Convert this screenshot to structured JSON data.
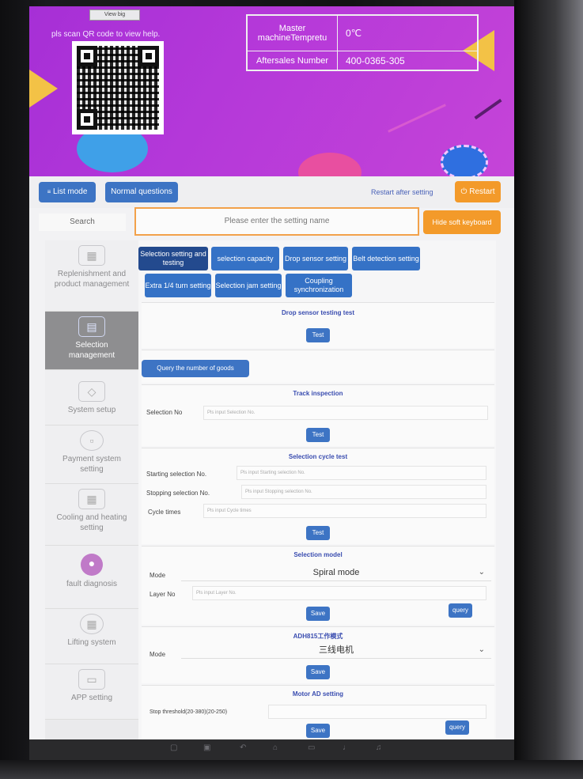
{
  "header": {
    "view_big": "View big",
    "scan_help": "pls scan QR code to view help.",
    "master_temp_label": "Master machineTempretu",
    "master_temp_value": "0℃",
    "aftersales_label": "Aftersales Number",
    "aftersales_value": "400-0365-305"
  },
  "toolbar": {
    "list_mode": "List mode",
    "normal_questions": "Normal questions",
    "restart_hint": "Restart after setting",
    "restart_button": "Restart",
    "search_label": "Search",
    "search_placeholder": "Please enter the setting name",
    "hide_keyboard": "Hide soft keyboard"
  },
  "sidebar": {
    "items": [
      {
        "label": "Replenishment and product management",
        "icon": "replenishment-icon"
      },
      {
        "label": "Selection management",
        "icon": "selection-icon"
      },
      {
        "label": "System setup",
        "icon": "layers-icon"
      },
      {
        "label": "Payment system setting",
        "icon": "payment-icon"
      },
      {
        "label": "Cooling and heating setting",
        "icon": "cooling-icon"
      },
      {
        "label": "fault diagnosis",
        "icon": "user-icon"
      },
      {
        "label": "Lifting system",
        "icon": "lifting-icon"
      },
      {
        "label": "APP setting",
        "icon": "app-icon"
      }
    ]
  },
  "tabs": [
    "Selection setting and testing",
    "selection capacity",
    "Drop sensor setting",
    "Belt detection setting",
    "Extra 1/4 turn setting",
    "Selection jam setting",
    "Coupling synchronization"
  ],
  "drop_sensor": {
    "title": "Drop sensor testing test",
    "test": "Test"
  },
  "query_goods": "Query the number of goods",
  "track": {
    "title": "Track inspection",
    "selection_label": "Selection No",
    "selection_placeholder": "Pls input Selection No.",
    "test": "Test"
  },
  "cycle": {
    "title": "Selection cycle test",
    "start_label": "Starting selection No.",
    "start_placeholder": "Pls input Starting selection No.",
    "stop_label": "Stopping selection No.",
    "stop_placeholder": "Pls input Stopping selection No.",
    "times_label": "Cycle times",
    "times_placeholder": "Pls input Cycle times",
    "test": "Test"
  },
  "model": {
    "title": "Selection model",
    "mode_label": "Mode",
    "mode_value": "Spiral mode",
    "layer_label": "Layer No",
    "layer_placeholder": "Pls input Layer No.",
    "save": "Save",
    "query": "query"
  },
  "adh": {
    "title": "ADH815工作模式",
    "mode_label": "Mode",
    "mode_value": "三线电机",
    "save": "Save"
  },
  "motor": {
    "title": "Motor AD setting",
    "stop_label": "Stop threshold(20-380)(20-250)",
    "save": "Save",
    "query": "query"
  },
  "colors": {
    "accent_blue": "#3d74c4",
    "accent_orange": "#f39a2a",
    "banner_purple": "#b438d9"
  }
}
